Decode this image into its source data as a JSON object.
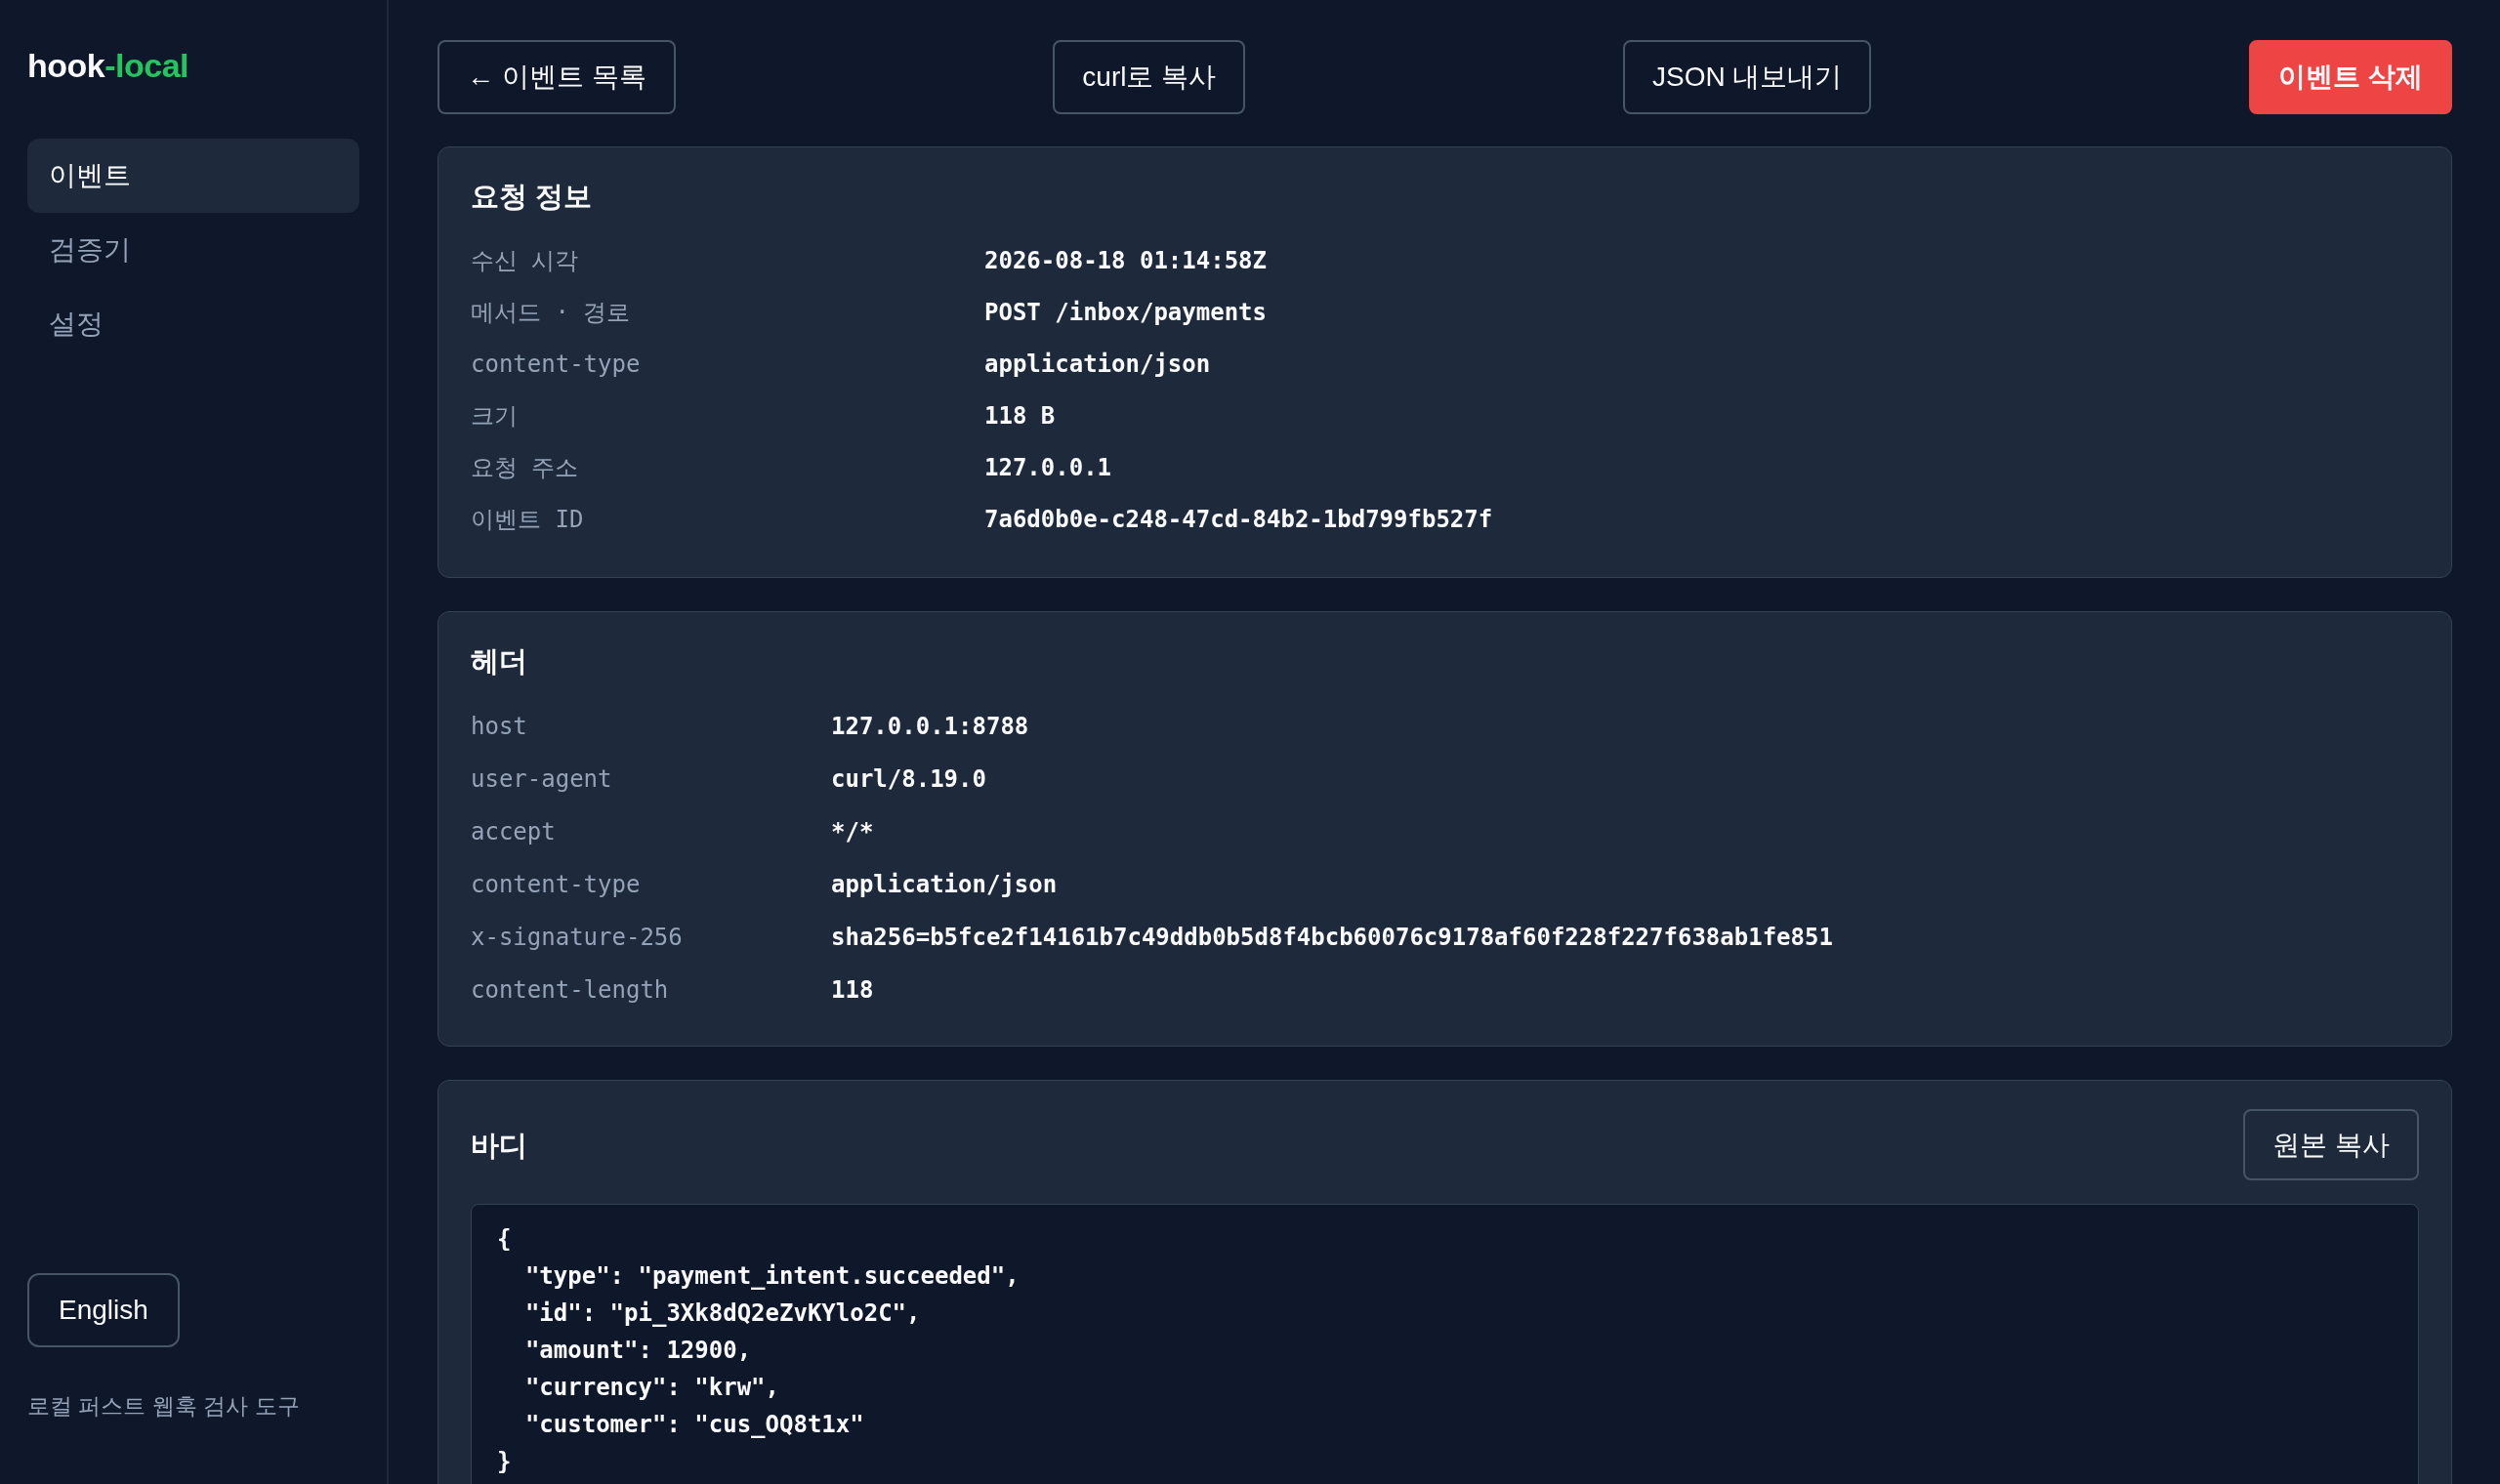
{
  "sidebar": {
    "logo": {
      "main": "hook",
      "accent": "-local"
    },
    "nav": [
      {
        "label": "이벤트",
        "selected": true
      },
      {
        "label": "검증기",
        "selected": false
      },
      {
        "label": "설정",
        "selected": false
      }
    ],
    "language_button": "English",
    "tagline": "로컬 퍼스트 웹훅 검사 도구"
  },
  "toolbar": {
    "buttons": [
      {
        "label": "← 이벤트 목록",
        "kind": "outline"
      },
      {
        "label": "curl로 복사",
        "kind": "outline"
      },
      {
        "label": "JSON 내보내기",
        "kind": "outline"
      },
      {
        "label": "이벤트 삭제",
        "kind": "danger"
      }
    ]
  },
  "request_info": {
    "title": "요청 정보",
    "rows": [
      {
        "label": "수신 시각",
        "value": "2026-08-18 01:14:58Z"
      },
      {
        "label": "메서드 · 경로",
        "value": "POST /inbox/payments"
      },
      {
        "label": "content-type",
        "value": "application/json"
      },
      {
        "label": "크기",
        "value": "118 B"
      },
      {
        "label": "요청 주소",
        "value": "127.0.0.1"
      },
      {
        "label": "이벤트 ID",
        "value": "7a6d0b0e-c248-47cd-84b2-1bd799fb527f"
      }
    ]
  },
  "headers": {
    "title": "헤더",
    "rows": [
      {
        "name": "host",
        "value": "127.0.0.1:8788"
      },
      {
        "name": "user-agent",
        "value": "curl/8.19.0"
      },
      {
        "name": "accept",
        "value": "*/*"
      },
      {
        "name": "content-type",
        "value": "application/json"
      },
      {
        "name": "x-signature-256",
        "value": "sha256=b5fce2f14161b7c49ddb0b5d8f4bcb60076c9178af60f228f227f638ab1fe851"
      },
      {
        "name": "content-length",
        "value": "118"
      }
    ]
  },
  "body": {
    "title": "바디",
    "copy_button": "원본 복사",
    "lines": [
      "{",
      "  \"type\": \"payment_intent.succeeded\",",
      "  \"id\": \"pi_3Xk8dQ2eZvKYlo2C\",",
      "  \"amount\": 12900,",
      "  \"currency\": \"krw\",",
      "  \"customer\": \"cus_OQ8t1x\"",
      "}"
    ]
  }
}
